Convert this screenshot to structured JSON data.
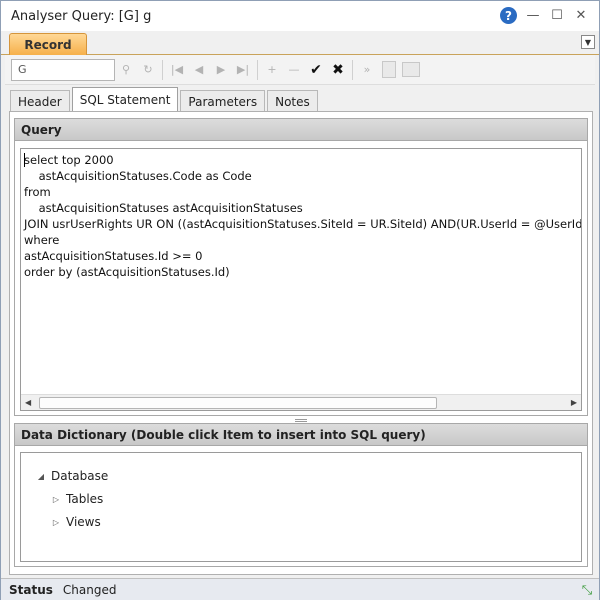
{
  "window": {
    "title": "Analyser Query: [G] g",
    "controls": {
      "help": "?",
      "minimize": "—",
      "maximize": "☐",
      "close": "✕"
    }
  },
  "ribbon": {
    "tab_label": "Record",
    "menu_glyph": "▼"
  },
  "toolbar": {
    "search_value": "G",
    "icons": {
      "search": "⚲",
      "refresh": "↻",
      "first": "|◀",
      "prev": "◀",
      "next": "▶",
      "last": "▶|",
      "add": "+",
      "remove": "—",
      "confirm": "✔",
      "cancel": "✖",
      "forward": "»"
    }
  },
  "tabs": [
    {
      "label": "Header",
      "selected": false
    },
    {
      "label": "SQL Statement",
      "selected": true
    },
    {
      "label": "Parameters",
      "selected": false
    },
    {
      "label": "Notes",
      "selected": false
    }
  ],
  "query_panel": {
    "title": "Query",
    "sql_lines": [
      "select top 2000",
      "    astAcquisitionStatuses.Code as Code",
      "from",
      "    astAcquisitionStatuses astAcquisitionStatuses",
      "JOIN usrUserRights UR ON ((astAcquisitionStatuses.SiteId = UR.SiteId) AND(UR.UserId = @UserId)",
      "where",
      "astAcquisitionStatuses.Id >= 0",
      "order by (astAcquisitionStatuses.Id)"
    ],
    "scroll_left": "◀",
    "scroll_right": "▶"
  },
  "dictionary_panel": {
    "title": "Data Dictionary (Double click Item to insert into SQL query)",
    "tree": {
      "root": {
        "label": "Database",
        "toggle": "◢"
      },
      "children": [
        {
          "label": "Tables",
          "toggle": "▷"
        },
        {
          "label": "Views",
          "toggle": "▷"
        }
      ]
    }
  },
  "statusbar": {
    "label": "Status",
    "value": "Changed",
    "grip": "⤡"
  },
  "colors": {
    "accent": "#f6b04a",
    "help": "#2a6bc2",
    "grip": "#3a9a3a"
  }
}
